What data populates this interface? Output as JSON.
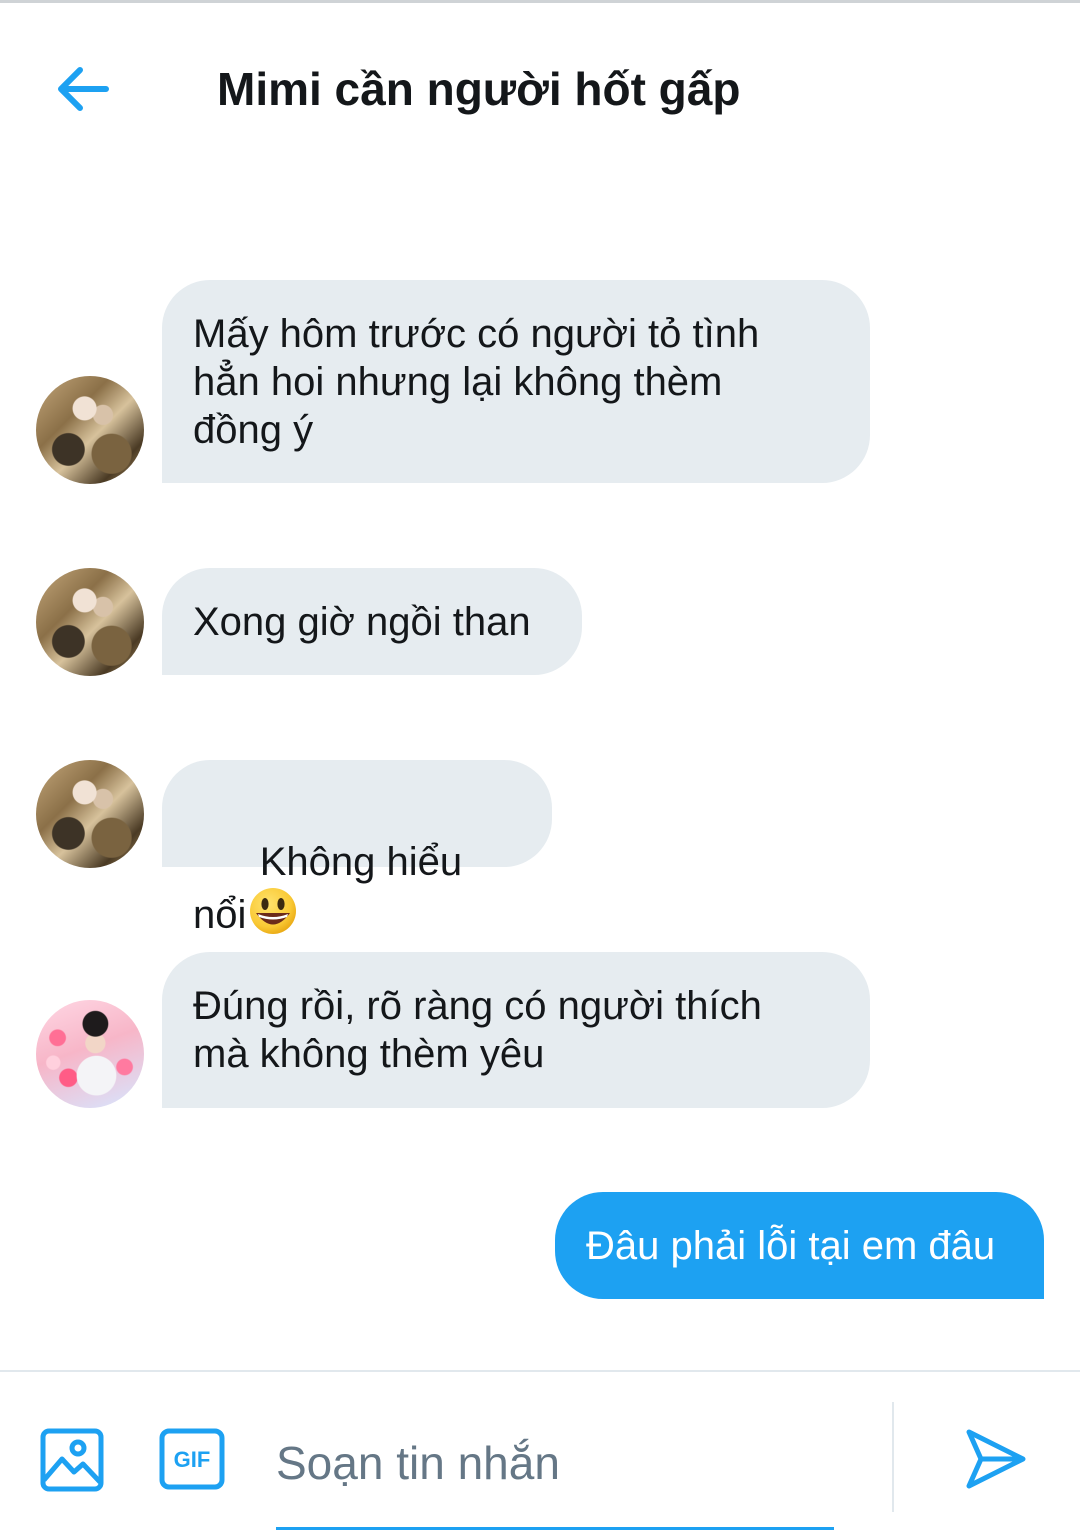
{
  "header": {
    "title": "Mimi cần người hốt gấp",
    "back_icon": "arrow-left-icon",
    "accent_color": "#1da1f2"
  },
  "messages": [
    {
      "direction": "incoming",
      "avatar": "user-avatar-a",
      "text": "Mấy hôm trước có người tỏ tình\nhẳn hoi nhưng lại không thèm\nđồng ý"
    },
    {
      "direction": "incoming",
      "avatar": "user-avatar-a",
      "text": "Xong giờ ngồi than"
    },
    {
      "direction": "incoming",
      "avatar": "user-avatar-a",
      "text": "Không hiểu nổi",
      "emoji": "grinning-face-emoji"
    },
    {
      "direction": "incoming",
      "avatar": "user-avatar-b",
      "text": "Đúng rồi, rõ ràng có người thích\nmà không thèm yêu"
    },
    {
      "direction": "outgoing",
      "text": "Đâu phải lỗi tại em đâu"
    }
  ],
  "composer": {
    "placeholder": "Soạn tin nhắn",
    "image_icon": "image-icon",
    "gif_icon": "gif-icon",
    "gif_label": "GIF",
    "send_icon": "send-icon"
  },
  "colors": {
    "incoming_bubble": "#e6ecf0",
    "outgoing_bubble": "#1da1f2",
    "text_primary": "#14171a",
    "placeholder": "#657786"
  }
}
